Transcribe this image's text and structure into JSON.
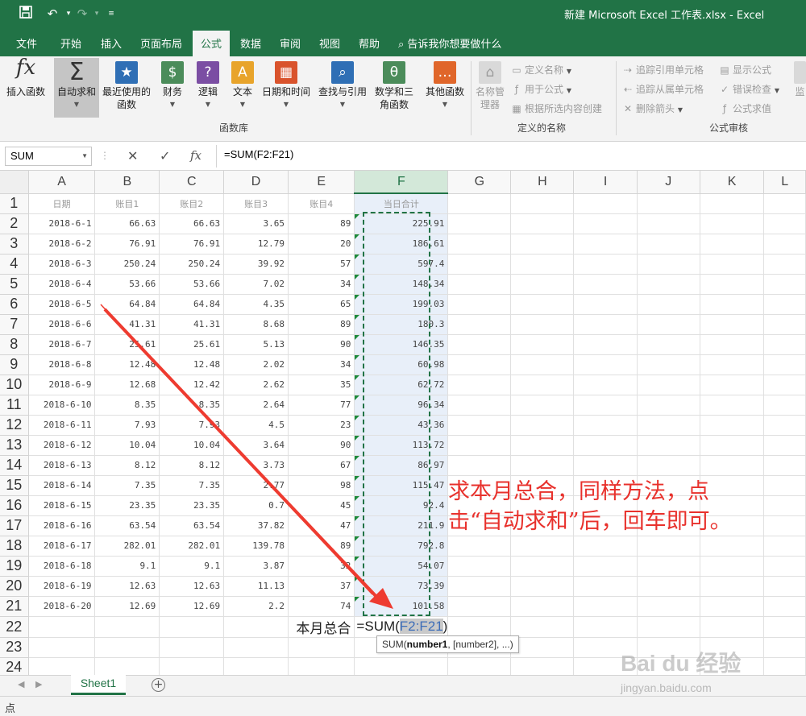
{
  "window": {
    "title": "新建 Microsoft Excel 工作表.xlsx  -  Excel"
  },
  "quick_access": [
    "save-icon",
    "undo-icon",
    "redo-icon",
    "customize-icon"
  ],
  "tabs": [
    "文件",
    "开始",
    "插入",
    "页面布局",
    "公式",
    "数据",
    "审阅",
    "视图",
    "帮助"
  ],
  "active_tab": "公式",
  "tell_me": "告诉我你想要做什么",
  "ribbon": {
    "insert_function": "插入函数",
    "function_library": [
      {
        "label": "自动求和",
        "icon": "Σ"
      },
      {
        "label": "最近使用的函数",
        "icon": "★"
      },
      {
        "label": "财务",
        "icon": "$"
      },
      {
        "label": "逻辑",
        "icon": "?"
      },
      {
        "label": "文本",
        "icon": "A"
      },
      {
        "label": "日期和时间",
        "icon": "▦"
      },
      {
        "label": "查找与引用",
        "icon": "⌕"
      },
      {
        "label": "数学和三角函数",
        "icon": "θ"
      },
      {
        "label": "其他函数",
        "icon": "…"
      }
    ],
    "function_library_label": "函数库",
    "name_manager": "名称管理器",
    "define_name": "定义名称",
    "use_in_formula": "用于公式",
    "create_from_selection": "根据所选内容创建",
    "defined_names_label": "定义的名称",
    "trace_precedents": "追踪引用单元格",
    "trace_dependents": "追踪从属单元格",
    "remove_arrows": "删除箭头",
    "show_formulas": "显示公式",
    "error_checking": "错误检查",
    "evaluate_formula": "公式求值",
    "formula_auditing_label": "公式审核",
    "watch_window": "监"
  },
  "formula_bar": {
    "name_box": "SUM",
    "formula": "=SUM(F2:F21)"
  },
  "columns": [
    "A",
    "B",
    "C",
    "D",
    "E",
    "F",
    "G",
    "H",
    "I",
    "J",
    "K",
    "L"
  ],
  "header_row": [
    "日期",
    "账目1",
    "账目2",
    "账目3",
    "账目4",
    "当日合计"
  ],
  "rows": [
    [
      "2018-6-1",
      "66.63",
      "66.63",
      "3.65",
      "89",
      "225.91"
    ],
    [
      "2018-6-2",
      "76.91",
      "76.91",
      "12.79",
      "20",
      "186.61"
    ],
    [
      "2018-6-3",
      "250.24",
      "250.24",
      "39.92",
      "57",
      "597.4"
    ],
    [
      "2018-6-4",
      "53.66",
      "53.66",
      "7.02",
      "34",
      "148.34"
    ],
    [
      "2018-6-5",
      "64.84",
      "64.84",
      "4.35",
      "65",
      "199.03"
    ],
    [
      "2018-6-6",
      "41.31",
      "41.31",
      "8.68",
      "89",
      "180.3"
    ],
    [
      "2018-6-7",
      "25.61",
      "25.61",
      "5.13",
      "90",
      "146.35"
    ],
    [
      "2018-6-8",
      "12.48",
      "12.48",
      "2.02",
      "34",
      "60.98"
    ],
    [
      "2018-6-9",
      "12.68",
      "12.42",
      "2.62",
      "35",
      "62.72"
    ],
    [
      "2018-6-10",
      "8.35",
      "8.35",
      "2.64",
      "77",
      "96.34"
    ],
    [
      "2018-6-11",
      "7.93",
      "7.93",
      "4.5",
      "23",
      "43.36"
    ],
    [
      "2018-6-12",
      "10.04",
      "10.04",
      "3.64",
      "90",
      "113.72"
    ],
    [
      "2018-6-13",
      "8.12",
      "8.12",
      "3.73",
      "67",
      "86.97"
    ],
    [
      "2018-6-14",
      "7.35",
      "7.35",
      "2.77",
      "98",
      "115.47"
    ],
    [
      "2018-6-15",
      "23.35",
      "23.35",
      "0.7",
      "45",
      "92.4"
    ],
    [
      "2018-6-16",
      "63.54",
      "63.54",
      "37.82",
      "47",
      "211.9"
    ],
    [
      "2018-6-17",
      "282.01",
      "282.01",
      "139.78",
      "89",
      "792.8"
    ],
    [
      "2018-6-18",
      "9.1",
      "9.1",
      "3.87",
      "32",
      "54.07"
    ],
    [
      "2018-6-19",
      "12.63",
      "12.63",
      "11.13",
      "37",
      "73.39"
    ],
    [
      "2018-6-20",
      "12.69",
      "12.69",
      "2.2",
      "74",
      "101.58"
    ]
  ],
  "row22": {
    "label": "本月总合",
    "edit_prefix": "=SUM(",
    "edit_ref": "F2:F21",
    "edit_suffix": ")"
  },
  "tooltip": {
    "func": "SUM(",
    "arg1": "number1",
    "rest": ", [number2], ...)"
  },
  "annotation": "求本月总合，同样方法，点击“自动求和”后，回车即可。",
  "sheet_tab": "Sheet1",
  "status": "点",
  "watermark": "Bai du 经验",
  "watermark_url": "jingyan.baidu.com",
  "colors": {
    "excel_green": "#217346",
    "annotation_red": "#e8312c",
    "selection_fill": "#e8eff9"
  }
}
